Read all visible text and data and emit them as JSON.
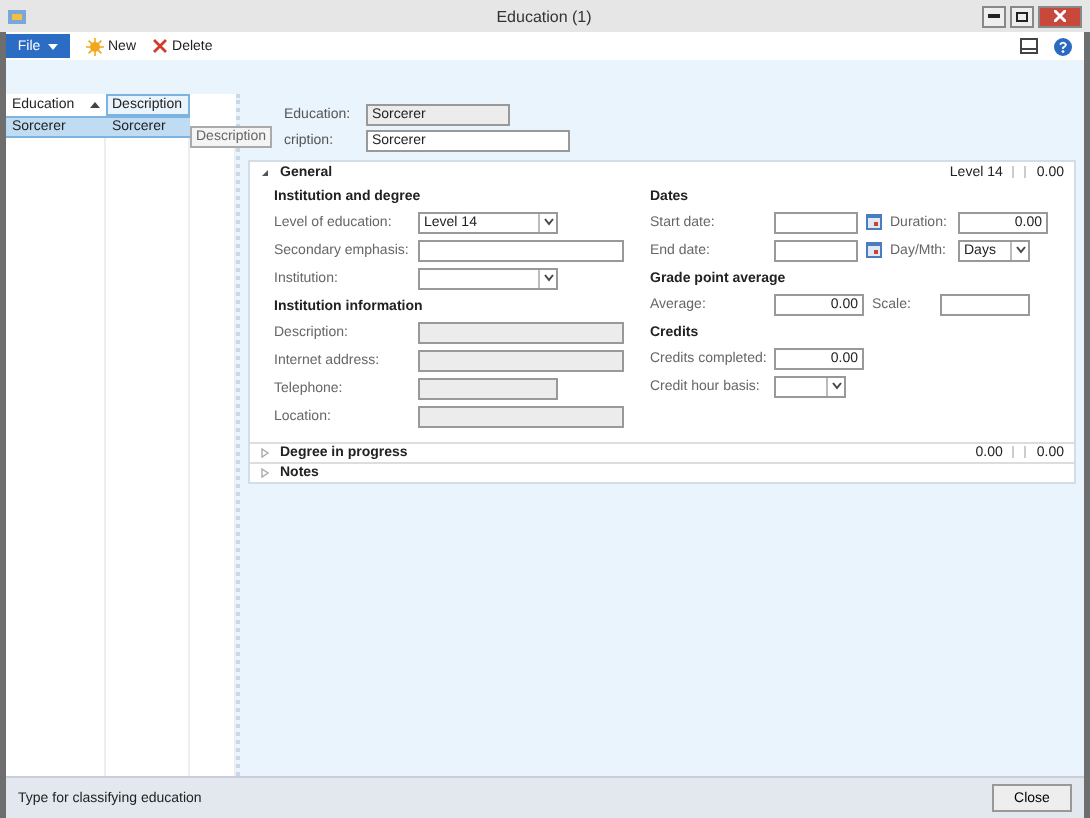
{
  "window": {
    "title": "Education (1)"
  },
  "toolbar": {
    "file_menu": "File",
    "buttons": [
      {
        "label": "New",
        "kind": "new"
      },
      {
        "label": "Delete",
        "kind": "delete"
      }
    ]
  },
  "grid": {
    "columns": [
      {
        "label": "Education",
        "sorted": true,
        "selected": false
      },
      {
        "label": "Description",
        "sorted": false,
        "selected": true
      }
    ],
    "rows": [
      {
        "cells": [
          "Sorcerer",
          "Sorcerer"
        ],
        "selected": true
      }
    ],
    "tooltip": "Description"
  },
  "header_fields": [
    {
      "label": "Education:",
      "value": "Sorcerer",
      "disabled": true
    },
    {
      "label": "cription:",
      "value": "Sorcerer",
      "disabled": false
    }
  ],
  "general": {
    "title": "General",
    "expanded": true,
    "summary": [
      "Level 14",
      "0.00"
    ],
    "left_groups": [
      {
        "title": "Institution and degree",
        "rows": [
          {
            "fields": [
              {
                "label": "Level of education:",
                "value": "Level 14",
                "kind": "select",
                "disabled": false
              }
            ]
          },
          {
            "fields": [
              {
                "label": "Secondary emphasis:",
                "kind": "text",
                "disabled": false
              }
            ]
          },
          {
            "fields": [
              {
                "label": "Institution:",
                "kind": "select",
                "disabled": false
              }
            ]
          }
        ]
      },
      {
        "title": "Institution information",
        "rows": [
          {
            "fields": [
              {
                "label": "Description:",
                "kind": "text",
                "disabled": true
              }
            ]
          },
          {
            "fields": [
              {
                "label": "Internet address:",
                "kind": "text",
                "disabled": true
              }
            ]
          },
          {
            "fields": [
              {
                "label": "Telephone:",
                "kind": "short",
                "disabled": true
              }
            ]
          },
          {
            "fields": [
              {
                "label": "Location:",
                "kind": "text",
                "disabled": true
              }
            ]
          }
        ]
      }
    ],
    "right_groups": [
      {
        "title": "Dates",
        "rows": [
          {
            "fields": [
              {
                "label": "Start date:",
                "kind": "date",
                "disabled": false
              },
              {
                "label": "Duration:",
                "value": "0.00",
                "kind": "number",
                "disabled": false
              }
            ]
          },
          {
            "fields": [
              {
                "label": "End date:",
                "kind": "date",
                "disabled": false
              },
              {
                "label": "Day/Mth:",
                "value": "Days",
                "kind": "select",
                "disabled": false
              }
            ]
          }
        ]
      },
      {
        "title": "Grade point average",
        "rows": [
          {
            "fields": [
              {
                "label": "Average:",
                "value": "0.00",
                "kind": "number",
                "disabled": false
              },
              {
                "label": "Scale:",
                "kind": "number",
                "disabled": false
              }
            ]
          }
        ]
      },
      {
        "title": "Credits",
        "rows": [
          {
            "fields": [
              {
                "label": "Credits completed:",
                "value": "0.00",
                "kind": "number",
                "disabled": false
              }
            ]
          },
          {
            "fields": [
              {
                "label": "Credit hour basis:",
                "kind": "select",
                "disabled": false
              }
            ]
          }
        ]
      }
    ]
  },
  "collapsed_sections": [
    {
      "title": "Degree in progress",
      "expanded": false,
      "summary": [
        "0.00",
        "0.00"
      ]
    },
    {
      "title": "Notes",
      "expanded": false
    }
  ],
  "status_bar": {
    "text": "Type for classifying education",
    "close_button": "Close"
  }
}
